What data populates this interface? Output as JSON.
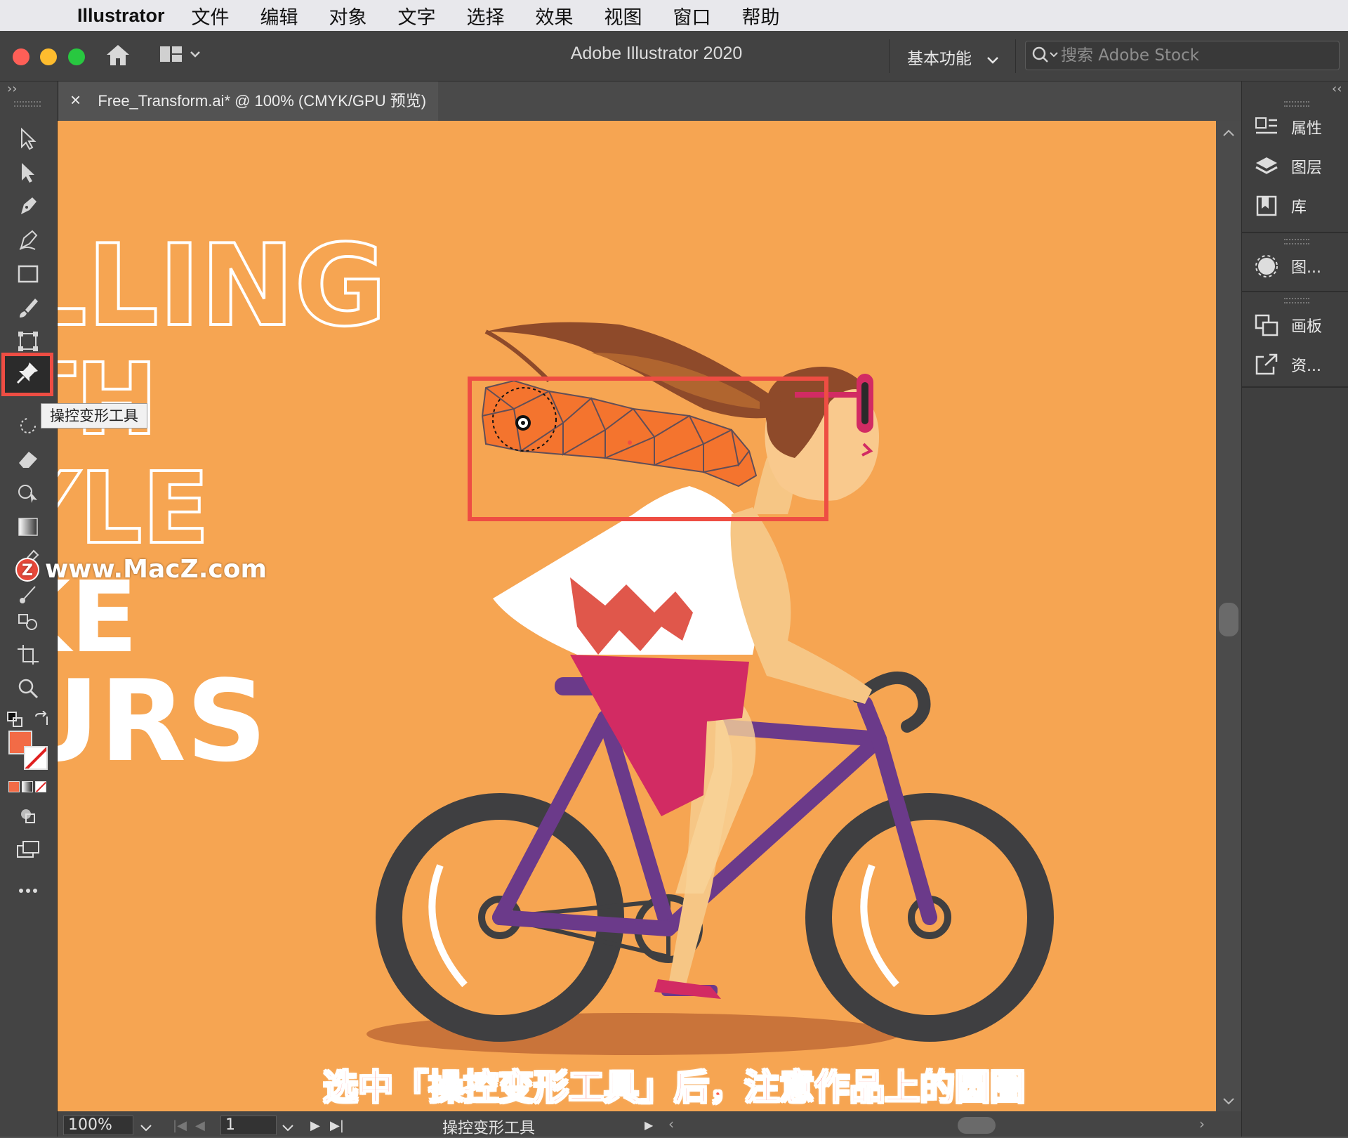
{
  "menubar": {
    "app_name": "Illustrator",
    "items": [
      "文件",
      "编辑",
      "对象",
      "文字",
      "选择",
      "效果",
      "视图",
      "窗口",
      "帮助"
    ]
  },
  "titlebar": {
    "title": "Adobe Illustrator 2020",
    "workspace": "基本功能",
    "search_placeholder": "搜索 Adobe Stock"
  },
  "document_tab": {
    "close": "×",
    "title": "Free_Transform.ai* @ 100% (CMYK/GPU 预览)"
  },
  "tooltip": "操控变形工具",
  "artwork_text": {
    "line1": "LLING",
    "line2": "TH",
    "line3": "YLE",
    "line4": "KE",
    "line5": "URS"
  },
  "watermark": "www.MacZ.com",
  "caption": "选中「操控变形工具」后，注意作品上的圆圈",
  "statusbar": {
    "zoom": "100%",
    "artboard": "1",
    "tool_name": "操控变形工具"
  },
  "right_panel": {
    "items": [
      "属性",
      "图层",
      "库",
      "图...",
      "画板",
      "资..."
    ]
  },
  "colors": {
    "canvas": "#f6a552",
    "highlight": "#ee4d43",
    "fill": "#f26b46"
  }
}
